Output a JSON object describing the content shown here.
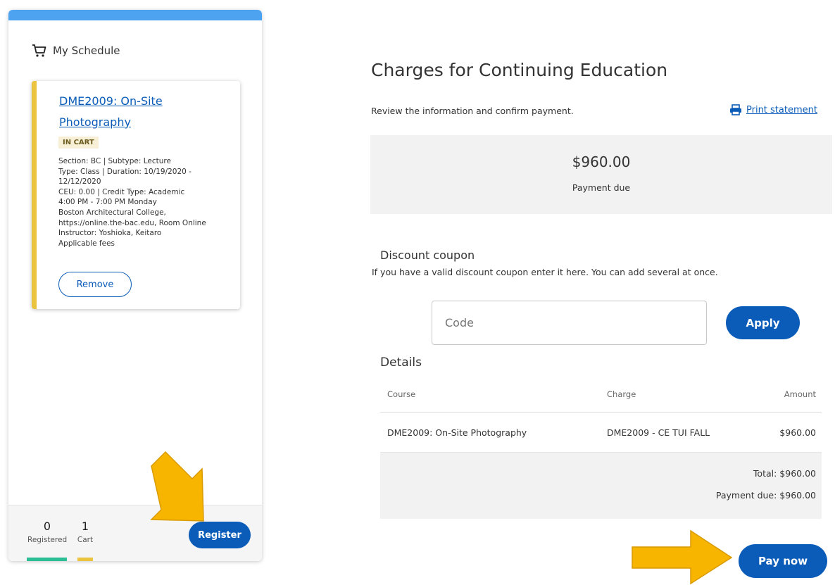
{
  "colors": {
    "accent_blue": "#0b5cb8",
    "top_bar_blue": "#4ea3f0",
    "cart_yellow": "#eac33f",
    "registered_green": "#2bbd93",
    "arrow_yellow": "#f7b500"
  },
  "schedule": {
    "header_icon": "cart-icon",
    "header_label": "My Schedule",
    "course": {
      "title": "DME2009: On-Site Photography",
      "status": "IN CART",
      "details": [
        "Section: BC | Subtype: Lecture",
        "Type: Class | Duration: 10/19/2020 -",
        "12/12/2020",
        "CEU: 0.00 | Credit Type: Academic",
        "4:00 PM - 7:00 PM Monday",
        "Boston Architectural College,",
        "https://online.the-bac.edu, Room Online",
        "Instructor: Yoshioka, Keitaro",
        "Applicable fees"
      ],
      "remove_label": "Remove"
    },
    "registered_count": "0",
    "registered_label": "Registered",
    "cart_count": "1",
    "cart_label": "Cart",
    "register_label": "Register"
  },
  "charges": {
    "title": "Charges for Continuing Education",
    "subtitle": "Review the information and confirm payment.",
    "print_icon": "printer-icon",
    "print_label": "Print statement",
    "payment_amount": "$960.00",
    "payment_label": "Payment due",
    "discount": {
      "title": "Discount coupon",
      "description": "If you have a valid discount coupon enter it here. You can add several at once.",
      "placeholder": "Code",
      "value": "",
      "apply_label": "Apply"
    },
    "details": {
      "title": "Details",
      "columns": [
        "Course",
        "Charge",
        "Amount"
      ],
      "rows": [
        [
          "DME2009: On-Site Photography",
          "DME2009 - CE TUI FALL",
          "$960.00"
        ]
      ]
    },
    "total_line": "Total: $960.00",
    "payment_due_line": "Payment due: $960.00",
    "pay_label": "Pay now"
  }
}
